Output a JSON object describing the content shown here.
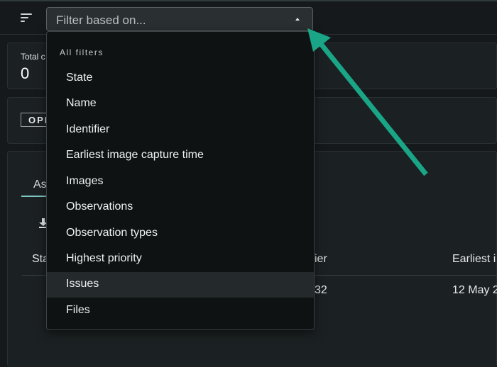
{
  "filter": {
    "placeholder": "Filter based on..."
  },
  "summary": {
    "total_label": "Total c",
    "total_value": "0"
  },
  "state_badge": "OPE",
  "assets_tab": "As",
  "table": {
    "headers": [
      "Sta",
      "ifier",
      "Earliest i"
    ],
    "row": {
      "identifier": "32",
      "earliest": "12 May 2"
    }
  },
  "dropdown": {
    "heading": "All filters",
    "items": [
      "State",
      "Name",
      "Identifier",
      "Earliest image capture time",
      "Images",
      "Observations",
      "Observation types",
      "Highest priority",
      "Issues",
      "Files"
    ],
    "highlighted_item": "Issues"
  },
  "colors": {
    "annotation_arrow": "#1aa587",
    "background": "#15191b",
    "menu_background": "#0e1213",
    "highlight": "#24292b",
    "tab_underline": "#7fc7c2"
  },
  "icons": {
    "sort": "sort-lines-icon",
    "caret": "caret-up-icon",
    "download": "download-icon",
    "annotation": "annotation-arrow-icon"
  }
}
